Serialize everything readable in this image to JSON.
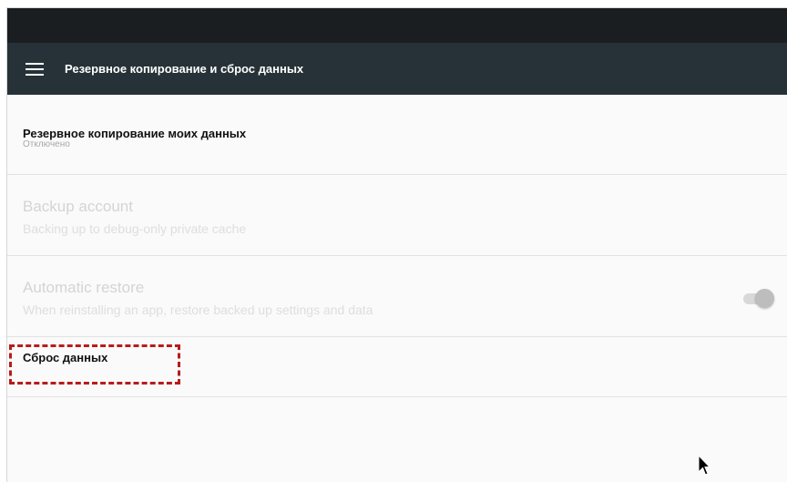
{
  "toolbar": {
    "title": "Резервное копирование и сброс данных",
    "menu_icon": "hamburger-menu-icon",
    "background": "#263238",
    "status_bar_color": "#1a1e21"
  },
  "preferences": [
    {
      "title": "Резервное копирование моих данных",
      "summary": "Отключено",
      "enabled": true
    },
    {
      "title": "Backup account",
      "summary": "Backing up to debug-only private cache",
      "enabled": false
    },
    {
      "title": "Automatic restore",
      "summary": "When reinstalling an app, restore backed up settings and data",
      "enabled": false,
      "toggle_on": true
    },
    {
      "title": "Сброс данных",
      "enabled": true,
      "highlighted": true
    }
  ],
  "highlight_color": "#b71c1c",
  "cursor_icon": "mouse-pointer-icon"
}
